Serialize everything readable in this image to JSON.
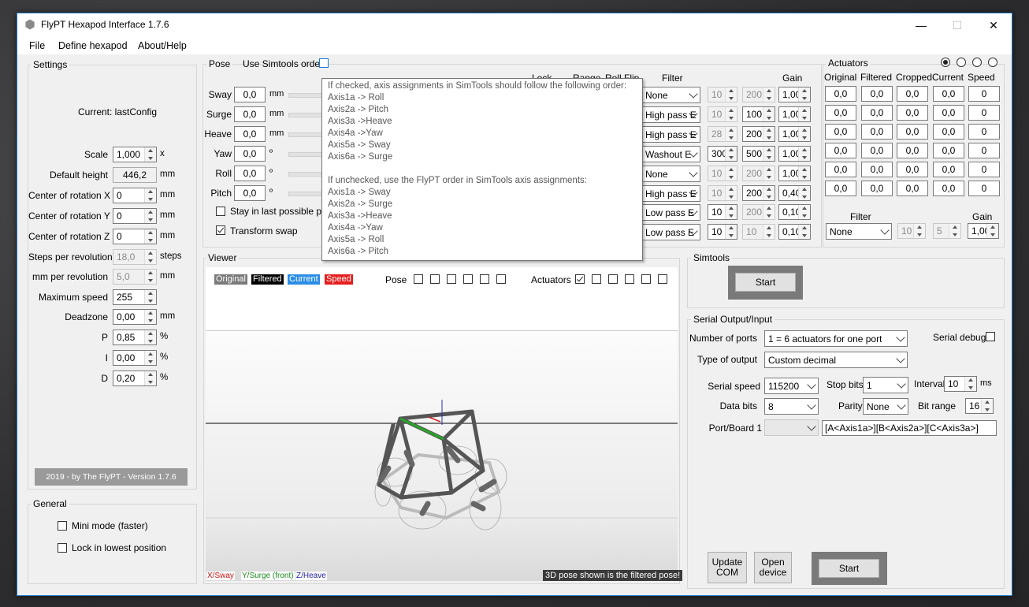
{
  "window": {
    "title": "FlyPT Hexapod Interface 1.7.6",
    "minimize": "—",
    "maximize": "☐",
    "close": "✕"
  },
  "menu": [
    "File",
    "Define hexapod",
    "About/Help"
  ],
  "settings": {
    "title": "Settings",
    "current": "Current: lastConfig",
    "rows": [
      {
        "label": "Scale",
        "value": "1,000",
        "unit": "x",
        "kind": "spin"
      },
      {
        "label": "Default height",
        "value": "446,2",
        "unit": "mm",
        "kind": "ro"
      },
      {
        "label": "Center of rotation X",
        "value": "0",
        "unit": "mm",
        "kind": "spin"
      },
      {
        "label": "Center of rotation Y",
        "value": "0",
        "unit": "mm",
        "kind": "spin"
      },
      {
        "label": "Center of rotation Z",
        "value": "0",
        "unit": "mm",
        "kind": "spin"
      },
      {
        "label": "Steps per revolution",
        "value": "18,0",
        "unit": "steps",
        "kind": "dis"
      },
      {
        "label": "mm per revolution",
        "value": "5,0",
        "unit": "mm",
        "kind": "dis"
      },
      {
        "label": "Maximum speed",
        "value": "255",
        "unit": "",
        "kind": "spin"
      },
      {
        "label": "Deadzone",
        "value": "0,00",
        "unit": "mm",
        "kind": "spin"
      },
      {
        "label": "P",
        "value": "0,85",
        "unit": "%",
        "kind": "spin"
      },
      {
        "label": "I",
        "value": "0,00",
        "unit": "%",
        "kind": "spin"
      },
      {
        "label": "D",
        "value": "0,20",
        "unit": "%",
        "kind": "spin"
      }
    ],
    "footer": "2019 - by The FlyPT - Version 1.7.6"
  },
  "general": {
    "title": "General",
    "mini_mode": "Mini mode (faster)",
    "lock_lowest": "Lock in lowest position"
  },
  "pose": {
    "title": "Pose",
    "use_simtools": "Use Simtools order",
    "headers": {
      "lock": "Lock",
      "range": "Range",
      "roll": "Roll",
      "flip": "Flip",
      "filter": "Filter",
      "gain": "Gain"
    },
    "rows": [
      {
        "label": "Sway",
        "value": "0,0",
        "unit": "mm",
        "filter": "None",
        "a": "10",
        "b": "200",
        "gain": "1,00",
        "adis": true,
        "bdis": true
      },
      {
        "label": "Surge",
        "value": "0,0",
        "unit": "mm",
        "filter": "High pass E",
        "a": "10",
        "b": "100",
        "gain": "1,00",
        "adis": true,
        "bdis": false
      },
      {
        "label": "Heave",
        "value": "0,0",
        "unit": "mm",
        "filter": "High pass E",
        "a": "28",
        "b": "200",
        "gain": "1,00",
        "adis": true,
        "bdis": false
      },
      {
        "label": "Yaw",
        "value": "0,0",
        "unit": "º",
        "filter": "Washout E",
        "a": "300",
        "b": "500",
        "gain": "1,00",
        "adis": false,
        "bdis": false
      },
      {
        "label": "Roll",
        "value": "0,0",
        "unit": "º",
        "filter": "None",
        "a": "10",
        "b": "200",
        "gain": "1,00",
        "adis": true,
        "bdis": true
      },
      {
        "label": "Pitch",
        "value": "0,0",
        "unit": "º",
        "filter": "High pass E",
        "a": "10",
        "b": "200",
        "gain": "0,40",
        "adis": true,
        "bdis": false
      },
      {
        "label": "",
        "value": "",
        "unit": "",
        "filter": "Low pass E",
        "a": "10",
        "b": "200",
        "gain": "0,10",
        "adis": false,
        "bdis": true
      },
      {
        "label": "",
        "value": "",
        "unit": "",
        "filter": "Low pass E",
        "a": "10",
        "b": "10",
        "gain": "0,10",
        "adis": false,
        "bdis": true
      }
    ],
    "stay_last": "Stay in last possible pose",
    "transform_swap": "Transform swap"
  },
  "tooltip": [
    "If checked, axis assignments in SimTools should follow the following order:",
    "Axis1a -> Roll",
    "Axis2a -> Pitch",
    "Axis3a ->Heave",
    "Axis4a ->Yaw",
    "Axis5a -> Sway",
    "Axis6a -> Surge",
    "",
    "If unchecked, use the FlyPT order in SimTools axis assignments:",
    "Axis1a -> Sway",
    "Axis2a -> Surge",
    "Axis3a ->Heave",
    "Axis4a ->Yaw",
    "Axis5a -> Roll",
    "Axis6a -> Pitch"
  ],
  "actuators": {
    "title": "Actuators",
    "headers": [
      "Original",
      "Filtered",
      "Cropped",
      "Current",
      "Speed"
    ],
    "rows": [
      [
        "0,0",
        "0,0",
        "0,0",
        "0,0",
        "0"
      ],
      [
        "0,0",
        "0,0",
        "0,0",
        "0,0",
        "0"
      ],
      [
        "0,0",
        "0,0",
        "0,0",
        "0,0",
        "0"
      ],
      [
        "0,0",
        "0,0",
        "0,0",
        "0,0",
        "0"
      ],
      [
        "0,0",
        "0,0",
        "0,0",
        "0,0",
        "0"
      ],
      [
        "0,0",
        "0,0",
        "0,0",
        "0,0",
        "0"
      ]
    ],
    "filter_label": "Filter",
    "gain_label": "Gain",
    "filter": "None",
    "a": "10",
    "b": "5",
    "gain": "1,00"
  },
  "viewer": {
    "title": "Viewer",
    "legend": [
      {
        "label": "Original",
        "color": "#7a7a7a"
      },
      {
        "label": "Filtered",
        "color": "#000000"
      },
      {
        "label": "Current",
        "color": "#2a8de6"
      },
      {
        "label": "Speed",
        "color": "#e61e1e"
      }
    ],
    "pose_label": "Pose",
    "actuators_label": "Actuators",
    "axes": [
      {
        "label": "X/Sway",
        "color": "#d01010"
      },
      {
        "label": "Y/Surge (front)",
        "color": "#1a8a1a"
      },
      {
        "label": "Z/Heave",
        "color": "#1a1aa0"
      }
    ],
    "note": "3D pose shown is the filtered pose!"
  },
  "simtools": {
    "title": "Simtools",
    "start": "Start"
  },
  "serial": {
    "title": "Serial Output/Input",
    "ports_label": "Number of ports",
    "ports_value": "1 = 6 actuators for one port",
    "serial_debug": "Serial debug",
    "type_label": "Type of output",
    "type_value": "Custom decimal",
    "speed_label": "Serial speed",
    "speed_value": "115200",
    "stop_label": "Stop bits",
    "stop_value": "1",
    "interval_label": "Interval",
    "interval_value": "10",
    "interval_unit": "ms",
    "data_label": "Data bits",
    "data_value": "8",
    "parity_label": "Parity",
    "parity_value": "None",
    "bitrange_label": "Bit range",
    "bitrange_value": "16",
    "port_label": "Port/Board 1",
    "port_value": "",
    "format": "[A<Axis1a>][B<Axis2a>][C<Axis3a>]",
    "update_com": "Update COM",
    "open_device": "Open device",
    "start": "Start"
  }
}
